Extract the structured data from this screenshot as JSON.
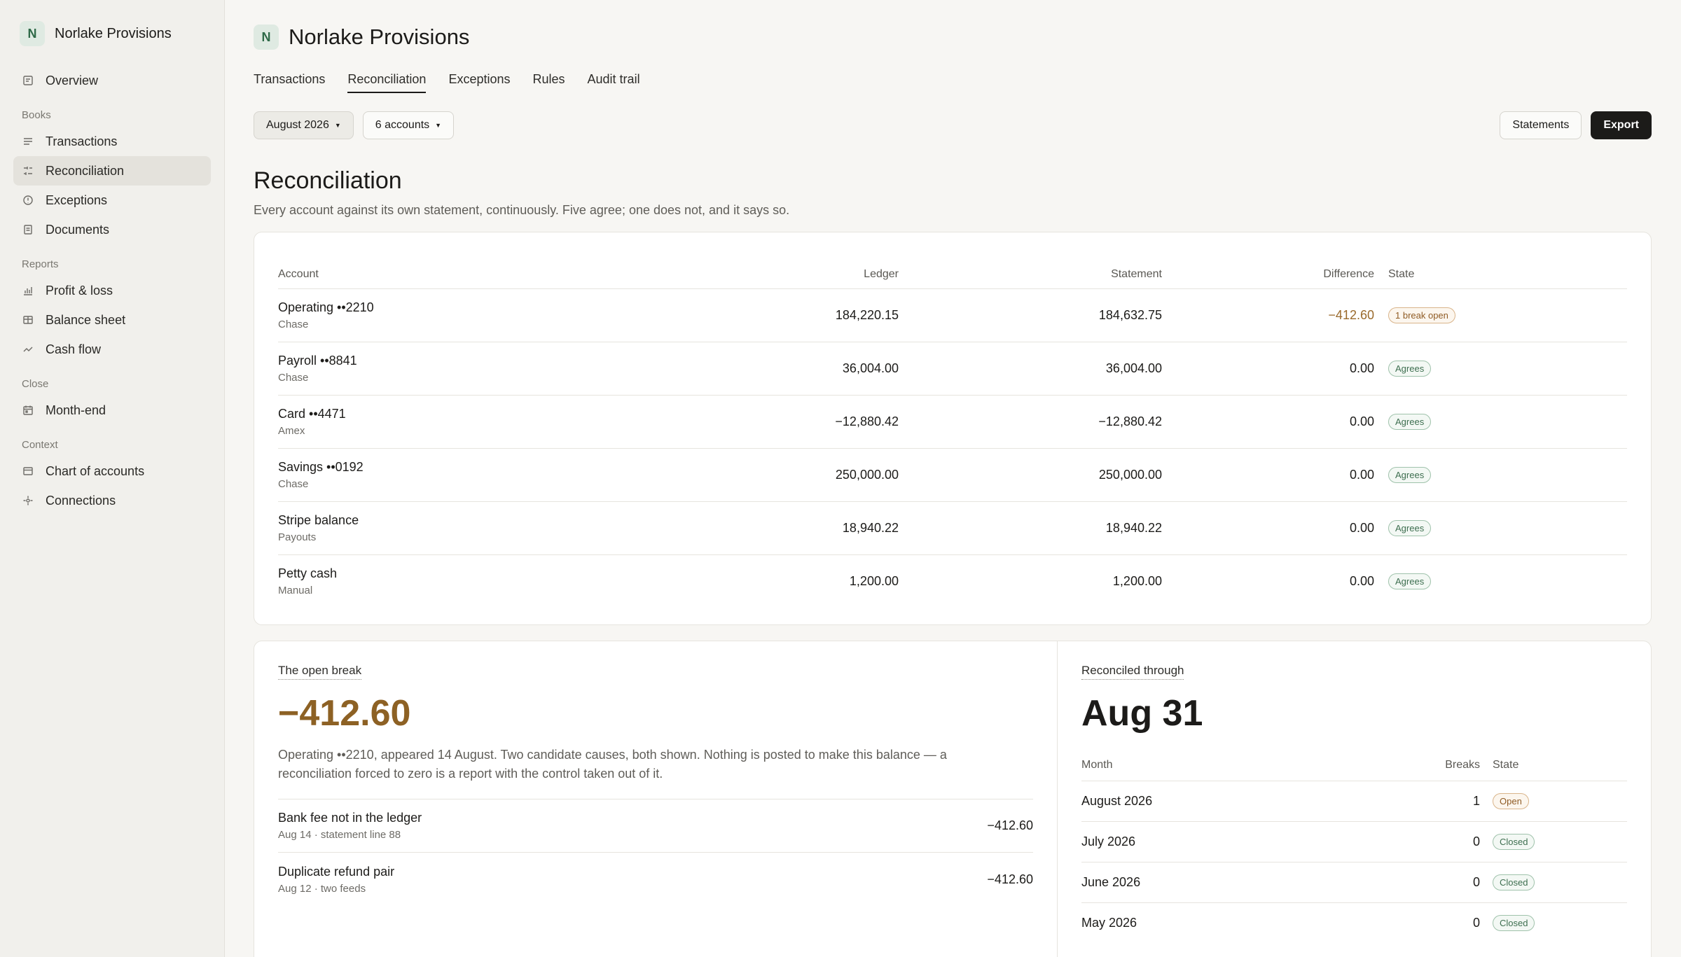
{
  "org": {
    "initial": "N",
    "name": "Norlake Provisions"
  },
  "sidebar": {
    "top": [
      {
        "label": "Overview",
        "icon": "overview-icon"
      }
    ],
    "sections": [
      {
        "title": "Books",
        "items": [
          {
            "label": "Transactions",
            "icon": "list-icon"
          },
          {
            "label": "Reconciliation",
            "icon": "sliders-icon",
            "active": true
          },
          {
            "label": "Exceptions",
            "icon": "alert-circle-icon"
          },
          {
            "label": "Documents",
            "icon": "document-icon"
          }
        ]
      },
      {
        "title": "Reports",
        "items": [
          {
            "label": "Profit & loss",
            "icon": "bar-chart-icon"
          },
          {
            "label": "Balance sheet",
            "icon": "columns-icon"
          },
          {
            "label": "Cash flow",
            "icon": "trend-icon"
          }
        ]
      },
      {
        "title": "Close",
        "items": [
          {
            "label": "Month-end",
            "icon": "calendar-icon"
          }
        ]
      },
      {
        "title": "Context",
        "items": [
          {
            "label": "Chart of accounts",
            "icon": "ledger-icon"
          },
          {
            "label": "Connections",
            "icon": "connections-icon"
          }
        ]
      }
    ]
  },
  "tabs": [
    "Transactions",
    "Reconciliation",
    "Exceptions",
    "Rules",
    "Audit trail"
  ],
  "toolbar": {
    "period": "August 2026",
    "accounts": "6 accounts",
    "statements": "Statements",
    "export": "Export"
  },
  "page": {
    "title": "Reconciliation",
    "subtitle": "Every account against its own statement, continuously. Five agree; one does not, and it says so."
  },
  "table": {
    "headers": {
      "account": "Account",
      "ledger": "Ledger",
      "statement": "Statement",
      "difference": "Difference",
      "state": "State"
    },
    "rows": [
      {
        "name": "Operating ••2210",
        "sub": "Chase",
        "ledger": "184,220.15",
        "statement": "184,632.75",
        "difference": "−412.60",
        "state": "1 break open",
        "warn": true
      },
      {
        "name": "Payroll ••8841",
        "sub": "Chase",
        "ledger": "36,004.00",
        "statement": "36,004.00",
        "difference": "0.00",
        "state": "Agrees"
      },
      {
        "name": "Card ••4471",
        "sub": "Amex",
        "ledger": "−12,880.42",
        "statement": "−12,880.42",
        "difference": "0.00",
        "state": "Agrees"
      },
      {
        "name": "Savings ••0192",
        "sub": "Chase",
        "ledger": "250,000.00",
        "statement": "250,000.00",
        "difference": "0.00",
        "state": "Agrees"
      },
      {
        "name": "Stripe balance",
        "sub": "Payouts",
        "ledger": "18,940.22",
        "statement": "18,940.22",
        "difference": "0.00",
        "state": "Agrees"
      },
      {
        "name": "Petty cash",
        "sub": "Manual",
        "ledger": "1,200.00",
        "statement": "1,200.00",
        "difference": "0.00",
        "state": "Agrees"
      }
    ]
  },
  "open_break": {
    "label": "The open break",
    "amount": "−412.60",
    "text": "Operating ••2210, appeared 14 August. Two candidate causes, both shown. Nothing is posted to make this balance — a reconciliation forced to zero is a report with the control taken out of it.",
    "causes": [
      {
        "title": "Bank fee not in the ledger",
        "sub": "Aug 14 · statement line 88",
        "amount": "−412.60"
      },
      {
        "title": "Duplicate refund pair",
        "sub": "Aug 12 · two feeds",
        "amount": "−412.60"
      }
    ]
  },
  "reconciled": {
    "label": "Reconciled through",
    "date": "Aug 31",
    "headers": {
      "month": "Month",
      "breaks": "Breaks",
      "state": "State"
    },
    "rows": [
      {
        "month": "August 2026",
        "breaks": "1",
        "state": "Open",
        "warn": true
      },
      {
        "month": "July 2026",
        "breaks": "0",
        "state": "Closed"
      },
      {
        "month": "June 2026",
        "breaks": "0",
        "state": "Closed"
      },
      {
        "month": "May 2026",
        "breaks": "0",
        "state": "Closed"
      }
    ]
  },
  "colors": {
    "accent": "#1c1b19",
    "warn": "#8d6124",
    "ok": "#3d6e4f"
  }
}
